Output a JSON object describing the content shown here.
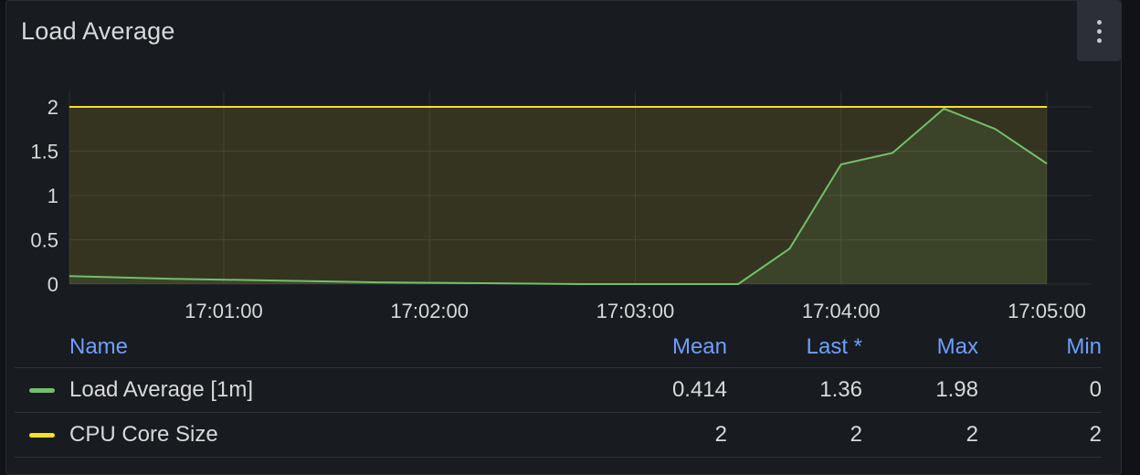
{
  "panel": {
    "title": "Load Average"
  },
  "colors": {
    "load": "#73bf69",
    "cpu": "#fade2a",
    "axis_text": "#d8d9da",
    "grid": "#2c2f35",
    "header": "#6e9fff"
  },
  "legend": {
    "headers": {
      "name": "Name",
      "mean": "Mean",
      "last": "Last *",
      "max": "Max",
      "min": "Min"
    },
    "rows": [
      {
        "name": "Load Average [1m]",
        "mean": "0.414",
        "last": "1.36",
        "max": "1.98",
        "min": "0",
        "color": "#73bf69"
      },
      {
        "name": "CPU Core Size",
        "mean": "2",
        "last": "2",
        "max": "2",
        "min": "2",
        "color": "#fade2a"
      }
    ]
  },
  "chart_data": {
    "type": "line",
    "x_range": [
      "17:00:15",
      "17:05:00"
    ],
    "y_range": [
      0,
      2
    ],
    "y_ticks": [
      "0",
      "0.5",
      "1",
      "1.5",
      "2"
    ],
    "x_ticks": [
      "17:01:00",
      "17:02:00",
      "17:03:00",
      "17:04:00",
      "17:05:00"
    ],
    "grid": true,
    "series": [
      {
        "name": "Load Average [1m]",
        "color": "#73bf69",
        "points": [
          [
            "17:00:15",
            0.09
          ],
          [
            "17:00:45",
            0.06
          ],
          [
            "17:01:15",
            0.04
          ],
          [
            "17:01:45",
            0.02
          ],
          [
            "17:02:15",
            0.01
          ],
          [
            "17:02:45",
            0.0
          ],
          [
            "17:03:15",
            0.0
          ],
          [
            "17:03:30",
            0.0
          ],
          [
            "17:03:45",
            0.4
          ],
          [
            "17:04:00",
            1.35
          ],
          [
            "17:04:15",
            1.48
          ],
          [
            "17:04:30",
            1.98
          ],
          [
            "17:04:45",
            1.75
          ],
          [
            "17:05:00",
            1.36
          ]
        ]
      },
      {
        "name": "CPU Core Size",
        "color": "#fade2a",
        "points": [
          [
            "17:00:15",
            2
          ],
          [
            "17:05:00",
            2
          ]
        ]
      }
    ]
  }
}
